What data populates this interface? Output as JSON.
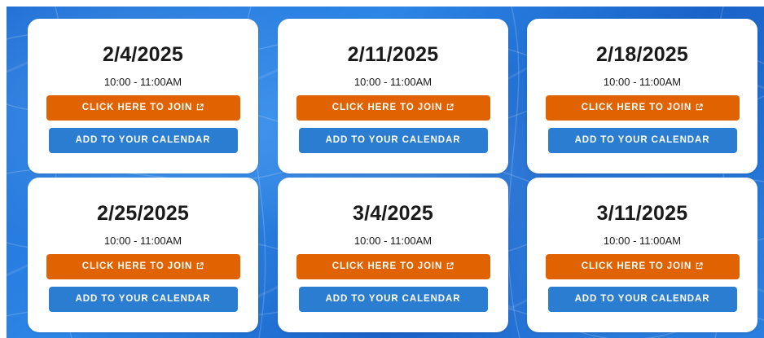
{
  "sessions": [
    {
      "date": "2/4/2025",
      "time": "10:00 - 11:00AM",
      "join_label": "CLICK HERE TO JOIN",
      "calendar_label": "ADD TO YOUR CALENDAR"
    },
    {
      "date": "2/11/2025",
      "time": "10:00 - 11:00AM",
      "join_label": "CLICK HERE TO JOIN",
      "calendar_label": "ADD TO YOUR CALENDAR"
    },
    {
      "date": "2/18/2025",
      "time": "10:00 - 11:00AM",
      "join_label": "CLICK HERE TO JOIN",
      "calendar_label": "ADD TO YOUR CALENDAR"
    },
    {
      "date": "2/25/2025",
      "time": "10:00 - 11:00AM",
      "join_label": "CLICK HERE TO JOIN",
      "calendar_label": "ADD TO YOUR CALENDAR"
    },
    {
      "date": "3/4/2025",
      "time": "10:00 - 11:00AM",
      "join_label": "CLICK HERE TO JOIN",
      "calendar_label": "ADD TO YOUR CALENDAR"
    },
    {
      "date": "3/11/2025",
      "time": "10:00 - 11:00AM",
      "join_label": "CLICK HERE TO JOIN",
      "calendar_label": "ADD TO YOUR CALENDAR"
    }
  ],
  "icons": {
    "join": "external-link-icon"
  },
  "colors": {
    "background": "#2a7fe0",
    "card": "#ffffff",
    "join_button": "#e06200",
    "calendar_button": "#2a7dd1",
    "text": "#1a1a1a"
  }
}
